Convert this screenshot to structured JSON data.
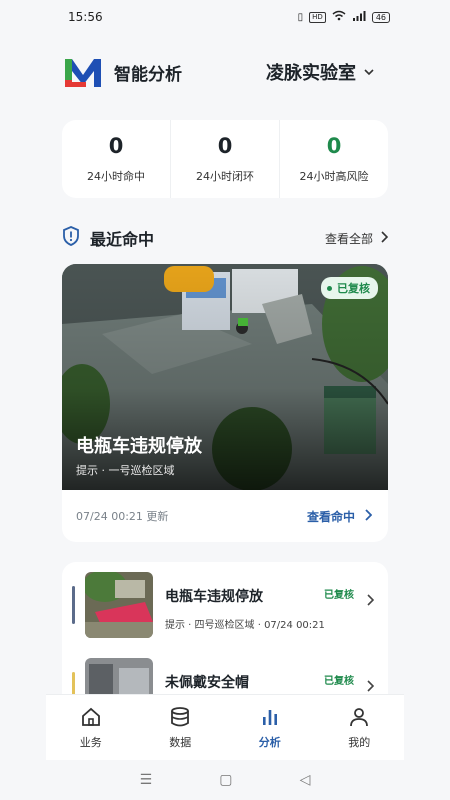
{
  "status_bar": {
    "time": "15:56",
    "hd": "HD",
    "network": "5G",
    "battery": "46"
  },
  "header": {
    "app_title": "智能分析",
    "lab_name": "凌脉实验室"
  },
  "stats": [
    {
      "value": "0",
      "label": "24小时命中"
    },
    {
      "value": "0",
      "label": "24小时闭环"
    },
    {
      "value": "0",
      "label": "24小时高风险"
    }
  ],
  "recent": {
    "title": "最近命中",
    "view_all": "查看全部"
  },
  "feature": {
    "badge": "已复核",
    "title": "电瓶车违规停放",
    "subtitle": "提示 · 一号巡检区域",
    "updated": "07/24 00:21 更新",
    "view_hit": "查看命中"
  },
  "list": [
    {
      "title": "电瓶车违规停放",
      "subtitle": "提示 · 四号巡检区域 · 07/24 00:21",
      "status": "已复核",
      "accent": "#5b6b8a"
    },
    {
      "title": "未佩戴安全帽",
      "subtitle": "",
      "status": "已复核",
      "accent": "#e3c25a"
    }
  ],
  "nav": [
    {
      "label": "业务",
      "icon": "home-icon"
    },
    {
      "label": "数据",
      "icon": "database-icon"
    },
    {
      "label": "分析",
      "icon": "bar-chart-icon",
      "active": true
    },
    {
      "label": "我的",
      "icon": "user-icon"
    }
  ],
  "colors": {
    "accent_blue": "#2b5fa8",
    "success_green": "#1f8a4c"
  }
}
